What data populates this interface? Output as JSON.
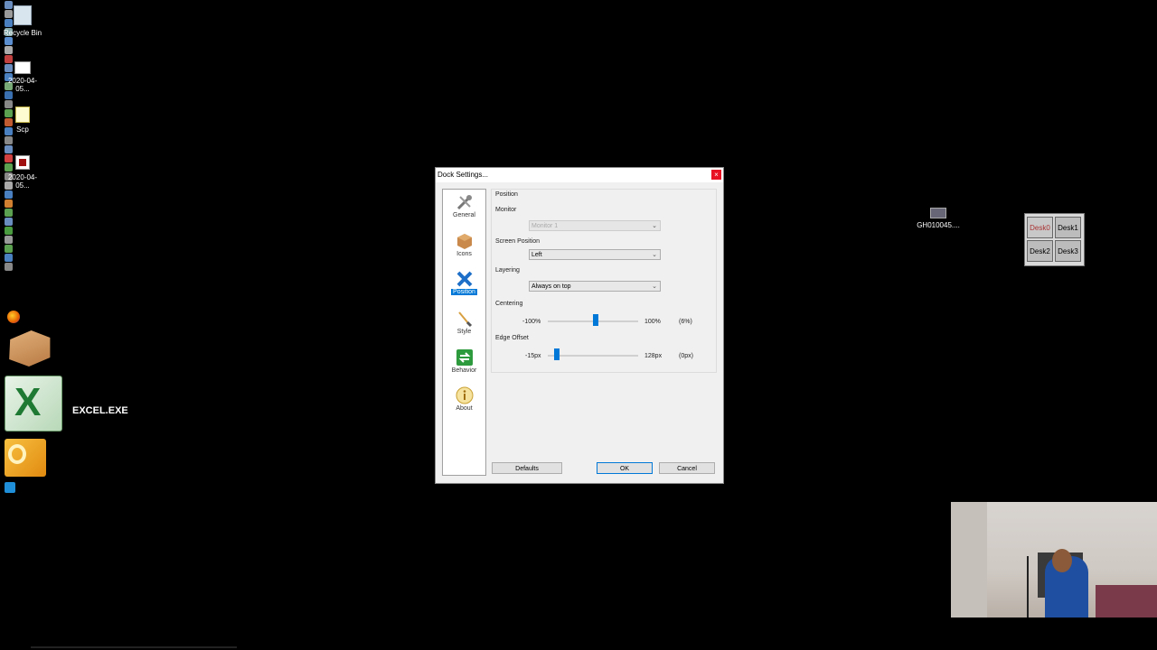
{
  "desktop": {
    "icons": [
      {
        "label": "Recycle Bin",
        "icon": "recycle-bin-icon"
      },
      {
        "label": "2020-04-05...",
        "icon": "screenshot-file-icon"
      },
      {
        "label": "Scp",
        "icon": "sticky-note-icon"
      },
      {
        "label": "2020-04-05...",
        "icon": "video-file-icon"
      },
      {
        "label": "GH010045....",
        "icon": "video-thumbnail-icon"
      }
    ],
    "excel_label": "EXCEL.EXE"
  },
  "dialog": {
    "title": "Dock Settings...",
    "close_label": "×",
    "nav": [
      {
        "label": "General",
        "icon": "tools-icon"
      },
      {
        "label": "Icons",
        "icon": "box-icon"
      },
      {
        "label": "Position",
        "icon": "position-icon",
        "active": true
      },
      {
        "label": "Style",
        "icon": "brush-icon"
      },
      {
        "label": "Behavior",
        "icon": "behavior-icon"
      },
      {
        "label": "About",
        "icon": "info-icon"
      }
    ],
    "section_title": "Position",
    "monitor": {
      "label": "Monitor",
      "value": "Monitor 1"
    },
    "screen_position": {
      "label": "Screen Position",
      "value": "Left"
    },
    "layering": {
      "label": "Layering",
      "value": "Always on top"
    },
    "centering": {
      "label": "Centering",
      "min": "-100%",
      "max": "100%",
      "current": "(6%)",
      "value": 6,
      "range": [
        -100,
        100
      ]
    },
    "edge_offset": {
      "label": "Edge Offset",
      "min": "-15px",
      "max": "128px",
      "current": "(0px)",
      "value": 0,
      "range": [
        -15,
        128
      ]
    },
    "buttons": {
      "defaults": "Defaults",
      "ok": "OK",
      "cancel": "Cancel"
    }
  },
  "pager": {
    "desks": [
      "Desk1",
      "Desk2",
      "Desk3"
    ],
    "active_label": "Desk0"
  },
  "colors": {
    "accent": "#0078d7",
    "close": "#e81123",
    "background": "#000000"
  }
}
